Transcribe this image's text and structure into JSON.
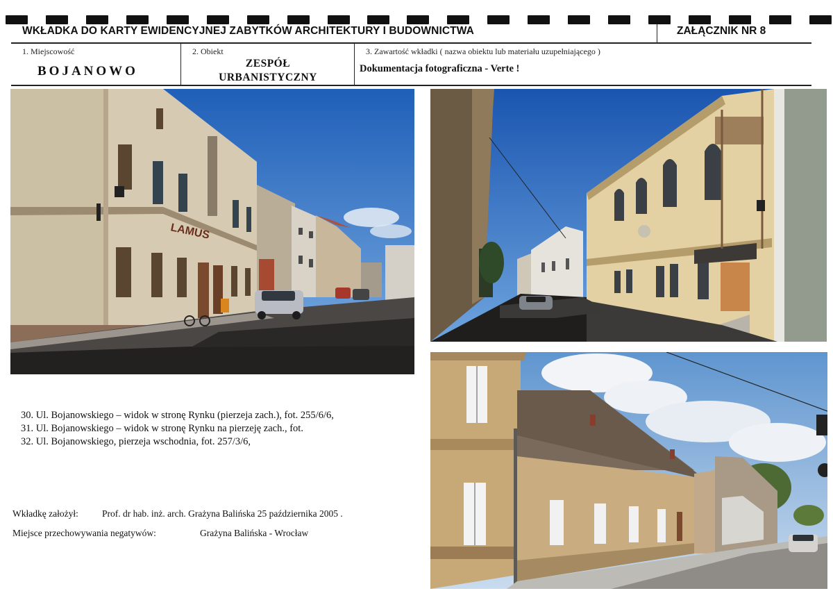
{
  "header": {
    "title": "WKŁADKA DO KARTY EWIDENCYJNEJ ZABYTKÓW ARCHITEKTURY I BUDOWNICTWA",
    "attachment": "ZAŁĄCZNIK NR 8"
  },
  "fields": {
    "place": {
      "label": "1. Miejscowość",
      "value": "BOJANOWO"
    },
    "object": {
      "label": "2. Obiekt",
      "value_line1": "ZESPÓŁ",
      "value_line2": "URBANISTYCZNY"
    },
    "content": {
      "label": "3. Zawartość wkładki ( nazwa obiektu lub materiału uzupełniającego )",
      "value": "Dokumentacja fotograficzna - Verte !"
    }
  },
  "photos": [
    {
      "icon": "street-photo-30-icon"
    },
    {
      "icon": "street-photo-31-icon"
    },
    {
      "icon": "street-photo-32-icon"
    }
  ],
  "signs": {
    "shop": "LAMUS"
  },
  "captions": [
    "30. Ul. Bojanowskiego – widok w stronę Rynku (pierzeja zach.), fot. 255/6/6,",
    "31. Ul. Bojanowskiego – widok w stronę Rynku na pierzeję zach., fot.",
    "32. Ul. Bojanowskiego, pierzeja wschodnia, fot. 257/3/6,"
  ],
  "footer": {
    "founder_label": "Wkładkę założył:",
    "founder_value": "Prof. dr hab. inż. arch. Grażyna Balińska  25 października 2005   .",
    "storage_label": "Miejsce przechowywania negatywów:",
    "storage_value": "Grażyna Balińska - Wrocław"
  },
  "colors": {
    "sky": "#2f6fc2",
    "facade_cream": "#d9cfb6",
    "facade_ochre": "#c9a76d",
    "road": "#2c2a28",
    "roof": "#6b5a4e"
  }
}
